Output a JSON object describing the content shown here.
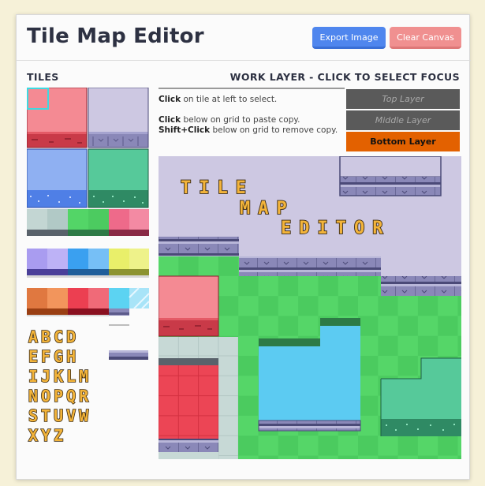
{
  "header": {
    "title": "Tile Map Editor",
    "export_label": "Export Image",
    "clear_label": "Clear Canvas"
  },
  "tiles": {
    "title": "TILES"
  },
  "work": {
    "title": "WORK LAYER - CLICK TO SELECT FOCUS",
    "instr1_bold": "Click",
    "instr1_rest": " on tile at left to select.",
    "instr2_bold": "Click",
    "instr2_rest": " below on grid to paste copy.",
    "instr3_bold": "Shift+Click",
    "instr3_rest": " below on grid to remove copy."
  },
  "layers": {
    "top": "Top Layer",
    "middle": "Middle Layer",
    "bottom": "Bottom Layer",
    "selected": "Bottom Layer"
  },
  "canvas_text": {
    "line1": "TILE",
    "line2": "MAP",
    "line3": "EDITOR"
  },
  "alphabet": [
    "ABCD",
    "EFGH",
    "IJKLM",
    "NOPQR",
    "STUVW",
    "XYZ"
  ],
  "colors": {
    "red": "#f48a93",
    "red_dark": "#c93a48",
    "lavender": "#cdc8e2",
    "stone": "#8a88b8",
    "blue": "#8fb0f2",
    "teal": "#56c99a",
    "grass_a": "#55d668",
    "grass_b": "#4bcb5f",
    "water": "#5ccbf2",
    "sky": "#cdc8e2",
    "gold": "#f3b43a",
    "accent": "#e36100"
  }
}
